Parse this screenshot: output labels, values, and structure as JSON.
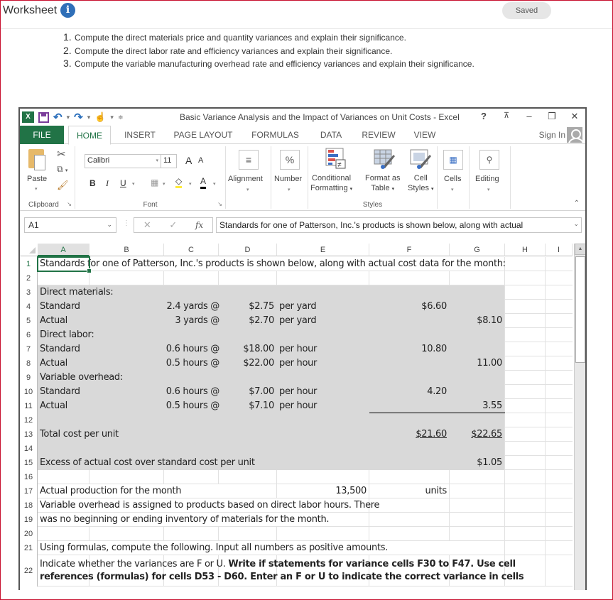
{
  "header": {
    "title": "Worksheet",
    "info_icon": "info-icon",
    "saved_label": "Saved"
  },
  "instructions": [
    {
      "num": "1.",
      "text": "Compute the direct materials price and quantity variances and explain their significance."
    },
    {
      "num": "2.",
      "text": "Compute the direct labor rate and efficiency variances and explain their significance."
    },
    {
      "num": "3.",
      "text": "Compute the variable manufacturing overhead rate and efficiency variances and explain their significance."
    }
  ],
  "excel": {
    "window_title": "Basic Variance Analysis and the Impact of Variances on Unit Costs - Excel",
    "qat": {
      "logo": "X",
      "undo": "↶",
      "redo": "↷",
      "touch": "☝"
    },
    "window_controls": {
      "help": "?",
      "ribbon_display": "⊼",
      "minimize": "–",
      "restore": "❐",
      "close": "✕"
    },
    "tabs": [
      "FILE",
      "HOME",
      "INSERT",
      "PAGE LAYOUT",
      "FORMULAS",
      "DATA",
      "REVIEW",
      "VIEW"
    ],
    "active_tab": "HOME",
    "sign_in": "Sign In",
    "ribbon": {
      "clipboard": {
        "label": "Clipboard",
        "paste": "Paste"
      },
      "font": {
        "label": "Font",
        "font_name": "Calibri",
        "font_size": "11",
        "bold": "B",
        "italic": "I",
        "underline": "U",
        "grow": "A",
        "shrink": "A",
        "font_color": "A"
      },
      "alignment": {
        "label": "Alignment"
      },
      "number": {
        "label": "Number",
        "icon": "%"
      },
      "styles": {
        "label": "Styles",
        "conditional_formatting": [
          "Conditional",
          "Formatting"
        ],
        "format_as_table": [
          "Format as",
          "Table"
        ],
        "cell_styles": [
          "Cell",
          "Styles"
        ]
      },
      "cells": {
        "label": "Cells"
      },
      "editing": {
        "label": "Editing"
      }
    },
    "formula_bar": {
      "name_box": "A1",
      "fx": "fx",
      "cancel": "✕",
      "enter": "✓",
      "content": "Standards for one of Patterson, Inc.'s products is shown below, along with actual"
    },
    "columns": [
      "A",
      "B",
      "C",
      "D",
      "E",
      "F",
      "G",
      "H",
      "I"
    ],
    "selected_column": "A",
    "rows": [
      {
        "n": "1",
        "A": "Standards for one of Patterson, Inc.'s products is shown below, along with actual cost data for the month:"
      },
      {
        "n": "2"
      },
      {
        "n": "3",
        "A": "Direct materials:"
      },
      {
        "n": "4",
        "A": "Standard",
        "B": "2.4 yards @",
        "D": "$2.75",
        "E": "per yard",
        "F": "$6.60"
      },
      {
        "n": "5",
        "A": "Actual",
        "B": "3 yards @",
        "D": "$2.70",
        "E": "per yard",
        "G": "$8.10"
      },
      {
        "n": "6",
        "A": "Direct labor:"
      },
      {
        "n": "7",
        "A": "Standard",
        "B": "0.6 hours @",
        "D": "$18.00",
        "E": "per hour",
        "F": "10.80"
      },
      {
        "n": "8",
        "A": "Actual",
        "B": "0.5 hours @",
        "D": "$22.00",
        "E": "per hour",
        "G": "11.00"
      },
      {
        "n": "9",
        "A": "Variable overhead:"
      },
      {
        "n": "10",
        "A": "Standard",
        "B": "0.6 hours @",
        "D": "$7.00",
        "E": "per hour",
        "F": "4.20"
      },
      {
        "n": "11",
        "A": "Actual",
        "B": "0.5 hours @",
        "D": "$7.10",
        "E": "per hour",
        "G": "3.55"
      },
      {
        "n": "12"
      },
      {
        "n": "13",
        "A": "Total cost per unit",
        "F": "$21.60",
        "G": "$22.65"
      },
      {
        "n": "14"
      },
      {
        "n": "15",
        "A": "Excess of actual cost over standard cost per unit",
        "G": "$1.05"
      },
      {
        "n": "16"
      },
      {
        "n": "17",
        "A": "Actual production for the month",
        "E": "13,500",
        "F": "units"
      },
      {
        "n": "18",
        "A": "Variable overhead is assigned to products based on direct labor hours. There"
      },
      {
        "n": "19",
        "A": "was no beginning or ending inventory of materials for the month."
      },
      {
        "n": "20"
      },
      {
        "n": "21",
        "A": "Using formulas, compute the following.  Input all numbers as positive amounts."
      },
      {
        "n": "22",
        "A_line1_plain": "Indicate whether the variances are F or U. ",
        "A_line1_bold": "Write if statements for variance cells F30 to F47. Use cell",
        "A_line2_bold": "references (formulas) for cells D53 - D60. Enter an  F or U to indicate the correct variance in cells"
      }
    ]
  }
}
